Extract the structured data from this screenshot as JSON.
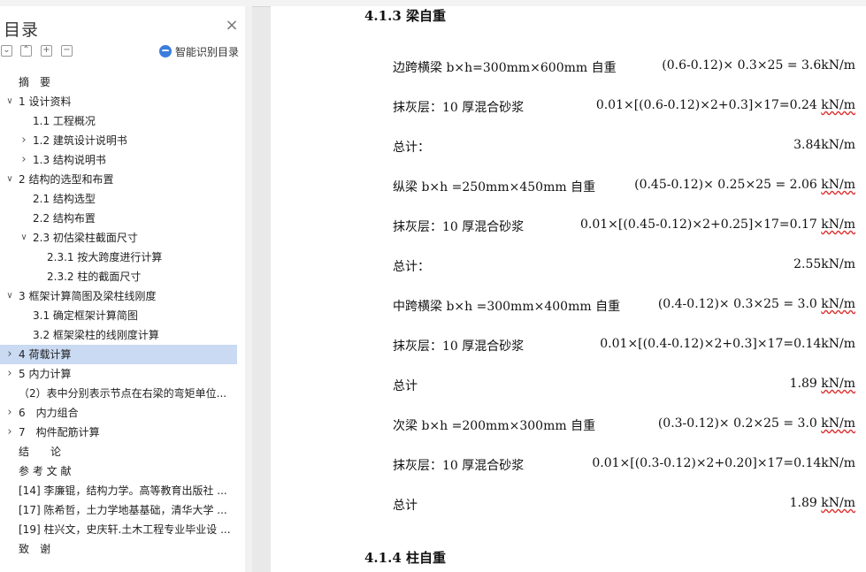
{
  "toc": {
    "title": "目录",
    "close_glyph": "×",
    "smart_label": "智能识别目录",
    "items": [
      {
        "label": "摘　要",
        "level": 0,
        "arrow": ""
      },
      {
        "label": "1  设计资料",
        "level": 0,
        "arrow": "down"
      },
      {
        "label": "1.1  工程概况",
        "level": 1,
        "arrow": ""
      },
      {
        "label": "1.2  建筑设计说明书",
        "level": 1,
        "arrow": "right"
      },
      {
        "label": "1.3  结构说明书",
        "level": 1,
        "arrow": "right"
      },
      {
        "label": "2  结构的选型和布置",
        "level": 0,
        "arrow": "down"
      },
      {
        "label": "2.1  结构选型",
        "level": 1,
        "arrow": ""
      },
      {
        "label": "2.2  结构布置",
        "level": 1,
        "arrow": ""
      },
      {
        "label": "2.3  初估梁柱截面尺寸",
        "level": 1,
        "arrow": "down"
      },
      {
        "label": "2.3.1  按大跨度进行计算",
        "level": 2,
        "arrow": ""
      },
      {
        "label": "2.3.2  柱的截面尺寸",
        "level": 2,
        "arrow": ""
      },
      {
        "label": "3  框架计算简图及梁柱线刚度",
        "level": 0,
        "arrow": "down"
      },
      {
        "label": "3.1  确定框架计算简图",
        "level": 1,
        "arrow": ""
      },
      {
        "label": "3.2  框架梁柱的线刚度计算",
        "level": 1,
        "arrow": ""
      },
      {
        "label": "4  荷载计算",
        "level": 0,
        "arrow": "right",
        "active": true
      },
      {
        "label": "5  内力计算",
        "level": 0,
        "arrow": "right"
      },
      {
        "label": "（2）表中分别表示节点在右梁的弯矩单位...",
        "level": 0,
        "arrow": ""
      },
      {
        "label": "6　内力组合",
        "level": 0,
        "arrow": "right"
      },
      {
        "label": "7　构件配筋计算",
        "level": 0,
        "arrow": "right"
      },
      {
        "label": "结　　论",
        "level": 0,
        "arrow": ""
      },
      {
        "label": "参 考 文 献",
        "level": 0,
        "arrow": ""
      },
      {
        "label": "[14]  李廉锟，结构力学。高等教育出版社 ...",
        "level": 0,
        "arrow": ""
      },
      {
        "label": "[17]  陈希哲，土力学地基基础，清华大学 ...",
        "level": 0,
        "arrow": ""
      },
      {
        "label": "[19]  柱兴文，史庆轩.土木工程专业毕业设 ...",
        "level": 0,
        "arrow": ""
      },
      {
        "label": "致　谢",
        "level": 0,
        "arrow": ""
      }
    ]
  },
  "doc": {
    "heading_top": "4.1.3  梁自重",
    "heading_bottom": "4.1.4  柱自重",
    "lines": [
      {
        "left": "边跨横梁 b×h=300mm×600mm 自重",
        "right": "(0.6-0.12)× 0.3×25 = 3.6kN/m",
        "unit_squig": false
      },
      {
        "left": "抹灰层：10 厚混合砂浆",
        "right": "0.01×[(0.6-0.12)×2+0.3]×17=0.24 kN/m",
        "unit_squig": true
      },
      {
        "left": "总计：",
        "right": "3.84kN/m",
        "unit_squig": false
      },
      {
        "left": "纵梁 b×h =250mm×450mm 自重",
        "right": "(0.45-0.12)× 0.25×25 = 2.06 kN/m",
        "unit_squig": true
      },
      {
        "left": "抹灰层：10 厚混合砂浆",
        "right": "0.01×[(0.45-0.12)×2+0.25]×17=0.17 kN/m",
        "unit_squig": true
      },
      {
        "left": "总计：",
        "right": "2.55kN/m",
        "unit_squig": false
      },
      {
        "left": "中跨横梁 b×h =300mm×400mm 自重",
        "right": "(0.4-0.12)× 0.3×25 = 3.0 kN/m",
        "unit_squig": true
      },
      {
        "left": "抹灰层：10 厚混合砂浆",
        "right": "0.01×[(0.4-0.12)×2+0.3]×17=0.14kN/m",
        "unit_squig": false
      },
      {
        "left": "总计",
        "right": "1.89 kN/m",
        "unit_squig": true
      },
      {
        "left": "次梁 b×h =200mm×300mm 自重",
        "right": "(0.3-0.12)× 0.2×25 = 3.0 kN/m",
        "unit_squig": true
      },
      {
        "left": "抹灰层：10 厚混合砂浆",
        "right": "0.01×[(0.3-0.12)×2+0.20]×17=0.14kN/m",
        "unit_squig": false
      },
      {
        "left": "总计",
        "right": "1.89 kN/m",
        "unit_squig": true
      }
    ]
  }
}
